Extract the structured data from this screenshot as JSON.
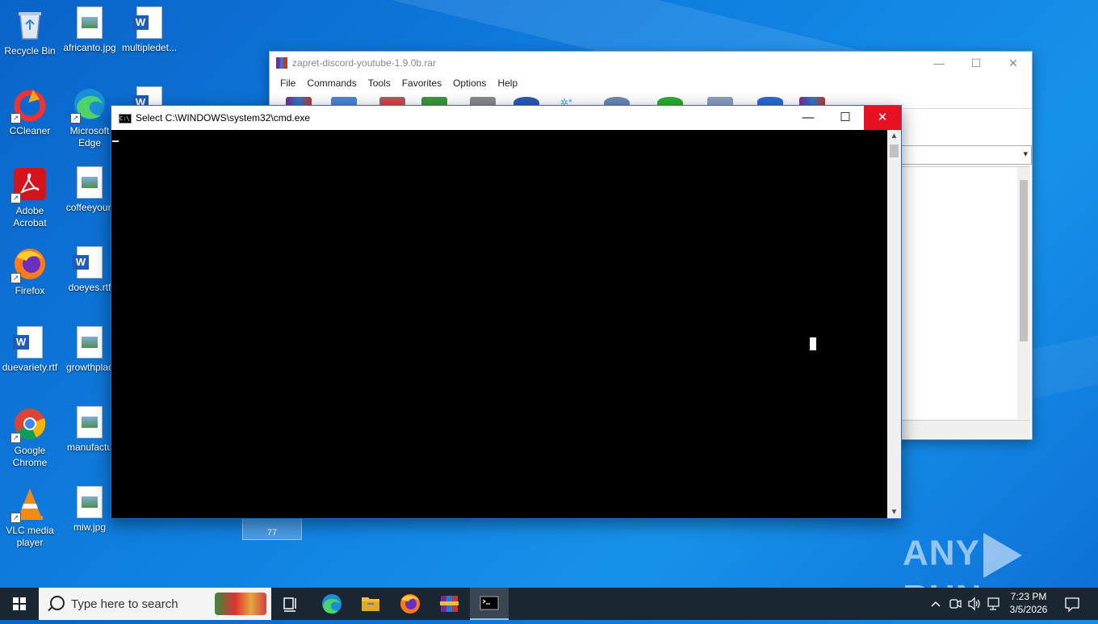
{
  "desktop": {
    "icons": [
      {
        "label": "Recycle Bin",
        "icon": "recycle-bin-icon"
      },
      {
        "label": "africanto.jpg",
        "icon": "image-file-icon"
      },
      {
        "label": "multipledet...",
        "icon": "word-doc-icon"
      },
      {
        "label": "CCleaner",
        "icon": "ccleaner-icon"
      },
      {
        "label": "Microsoft Edge",
        "icon": "edge-icon"
      },
      {
        "label": "Adobe Acrobat",
        "icon": "acrobat-icon"
      },
      {
        "label": "coffeeyoun",
        "icon": "image-file-icon"
      },
      {
        "label": "Firefox",
        "icon": "firefox-icon"
      },
      {
        "label": "doeyes.rtf",
        "icon": "word-doc-icon"
      },
      {
        "label": "duevariety.rtf",
        "icon": "word-doc-icon"
      },
      {
        "label": "growthplac",
        "icon": "image-file-icon"
      },
      {
        "label": "Google Chrome",
        "icon": "chrome-icon"
      },
      {
        "label": "manufactu",
        "icon": "image-file-icon"
      },
      {
        "label": "VLC media player",
        "icon": "vlc-icon"
      },
      {
        "label": "miw.jpg",
        "icon": "image-file-icon"
      }
    ],
    "drag_tile_label": "77"
  },
  "winrar": {
    "title": "zapret-discord-youtube-1.9.0b.rar",
    "menu": [
      "File",
      "Commands",
      "Tools",
      "Favorites",
      "Options",
      "Help"
    ],
    "controls": {
      "minimize": "—",
      "maximize": "☐",
      "close": "✕"
    }
  },
  "cmd": {
    "title": "Select C:\\WINDOWS\\system32\\cmd.exe",
    "controls": {
      "minimize": "—",
      "maximize": "☐",
      "close": "✕"
    }
  },
  "watermark": {
    "left": "ANY",
    "right": "RUN"
  },
  "taskbar": {
    "search_placeholder": "Type here to search",
    "clock_time": "7:23 PM",
    "clock_date": "3/5/2026"
  },
  "colors": {
    "desktop": "#0f7fe0",
    "taskbar": "#1b2633",
    "close_red": "#e81123"
  }
}
